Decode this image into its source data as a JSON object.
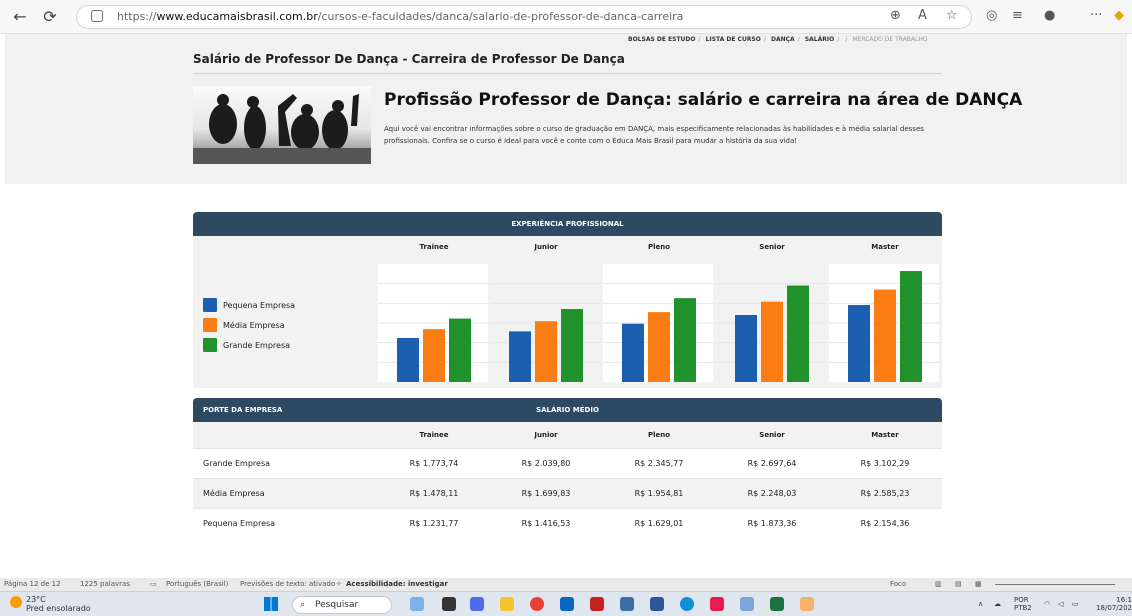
{
  "browser": {
    "url_prefix": "https://",
    "url_domain": "www.educamaisbrasil.com.br",
    "url_path": "/cursos-e-faculdades/danca/salario-de-professor-de-danca-carreira"
  },
  "breadcrumb": {
    "items": [
      "BOLSAS DE ESTUDO",
      "LISTA DE CURSO",
      "DANÇA",
      "SALÁRIO"
    ],
    "last": "MERCADO DE TRABALHO"
  },
  "page_title": "Salário de Professor De Dança - Carreira de Professor De Dança",
  "hero": {
    "title": "Profissão Professor de Dança: salário e carreira na área de DANÇA",
    "description": "Aqui você vai encontrar informações sobre o curso de graduação em DANÇA, mais especificamente relacionadas às habilidades e à média salarial desses profissionais. Confira se o curso é ideal para você e conte com o Educa Mais Brasil para mudar a história da sua vida!"
  },
  "chart_table": {
    "header": "EXPERIÊNCIA PROFISSIONAL"
  },
  "chart_data": {
    "type": "bar",
    "categories": [
      "Trainee",
      "Junior",
      "Pleno",
      "Senior",
      "Master"
    ],
    "series": [
      {
        "name": "Pequena Empresa",
        "color": "#1b5fae",
        "values": [
          1231.77,
          1416.53,
          1629.01,
          1873.36,
          2154.36
        ]
      },
      {
        "name": "Média Empresa",
        "color": "#f97d12",
        "values": [
          1478.11,
          1699.83,
          1954.81,
          2248.03,
          2585.23
        ]
      },
      {
        "name": "Grande Empresa",
        "color": "#21912b",
        "values": [
          1773.74,
          2039.8,
          2345.77,
          2697.64,
          3102.29
        ]
      }
    ],
    "ylim": [
      0,
      3300
    ]
  },
  "salary_table": {
    "left_header": "PORTE DA EMPRESA",
    "header": "SALÁRIO MÉDIO",
    "columns": [
      "Trainee",
      "Junior",
      "Pleno",
      "Senior",
      "Master"
    ],
    "rows": [
      {
        "label": "Grande Empresa",
        "values": [
          "R$ 1.773,74",
          "R$ 2.039,80",
          "R$ 2.345,77",
          "R$ 2.697,64",
          "R$ 3.102,29"
        ]
      },
      {
        "label": "Média Empresa",
        "values": [
          "R$ 1.478,11",
          "R$ 1.699,83",
          "R$ 1.954,81",
          "R$ 2.248,03",
          "R$ 2.585,23"
        ]
      },
      {
        "label": "Pequena Empresa",
        "values": [
          "R$ 1.231,77",
          "R$ 1.416,53",
          "R$ 1.629,01",
          "R$ 1.873,36",
          "R$ 2.154,36"
        ]
      }
    ]
  },
  "statusbar": {
    "page": "Página 12 de 12",
    "words": "1225 palavras",
    "language": "Português (Brasil)",
    "predictions": "Previsões de texto: ativado",
    "accessibility": "Acessibilidade: investigar",
    "focus": "Foco"
  },
  "taskbar": {
    "temp": "23°C",
    "weather": "Pred ensolarado",
    "search": "Pesquisar",
    "lang": "POR",
    "layout": "PTB2",
    "time": "16:1",
    "date": "18/07/202"
  }
}
